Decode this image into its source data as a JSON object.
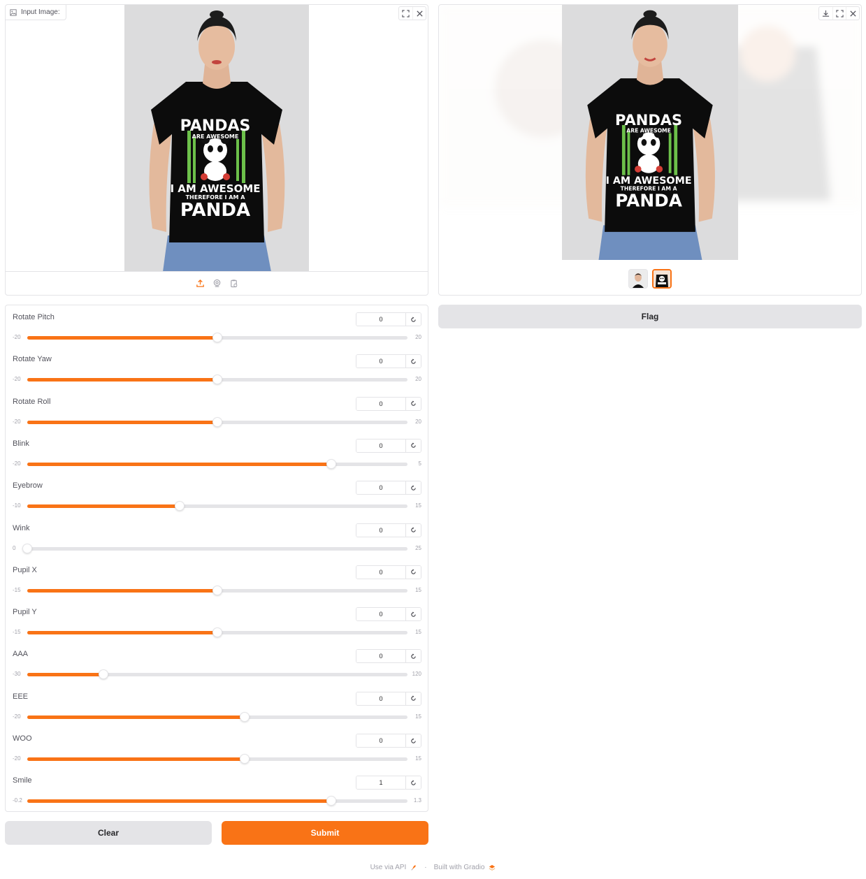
{
  "input_image": {
    "label": "Input Image:",
    "icons": [
      "image-icon",
      "fullscreen-icon",
      "close-icon"
    ],
    "sources": [
      "upload-icon",
      "webcam-icon",
      "clipboard-icon"
    ]
  },
  "output_gallery": {
    "icons": [
      "download-icon",
      "fullscreen-icon",
      "close-icon"
    ],
    "thumbnail_count": 2,
    "selected_index": 1
  },
  "shirt": {
    "line1": "PANDAS",
    "line2": "ARE AWESOME",
    "line3": "I AM AWESOME",
    "line4": "THEREFORE I AM A",
    "line5": "PANDA"
  },
  "sliders": [
    {
      "label": "Rotate Pitch",
      "value": "0",
      "min": "-20",
      "max": "20",
      "fraction": 0.5
    },
    {
      "label": "Rotate Yaw",
      "value": "0",
      "min": "-20",
      "max": "20",
      "fraction": 0.5
    },
    {
      "label": "Rotate Roll",
      "value": "0",
      "min": "-20",
      "max": "20",
      "fraction": 0.5
    },
    {
      "label": "Blink",
      "value": "0",
      "min": "-20",
      "max": "5",
      "fraction": 0.8
    },
    {
      "label": "Eyebrow",
      "value": "0",
      "min": "-10",
      "max": "15",
      "fraction": 0.4
    },
    {
      "label": "Wink",
      "value": "0",
      "min": "0",
      "max": "25",
      "fraction": 0.0
    },
    {
      "label": "Pupil X",
      "value": "0",
      "min": "-15",
      "max": "15",
      "fraction": 0.5
    },
    {
      "label": "Pupil Y",
      "value": "0",
      "min": "-15",
      "max": "15",
      "fraction": 0.5
    },
    {
      "label": "AAA",
      "value": "0",
      "min": "-30",
      "max": "120",
      "fraction": 0.2
    },
    {
      "label": "EEE",
      "value": "0",
      "min": "-20",
      "max": "15",
      "fraction": 0.571
    },
    {
      "label": "WOO",
      "value": "0",
      "min": "-20",
      "max": "15",
      "fraction": 0.571
    },
    {
      "label": "Smile",
      "value": "1",
      "min": "-0.2",
      "max": "1.3",
      "fraction": 0.8
    }
  ],
  "buttons": {
    "clear": "Clear",
    "submit": "Submit",
    "flag": "Flag"
  },
  "footer": {
    "api": "Use via API",
    "separator": "·",
    "built": "Built with Gradio"
  },
  "colors": {
    "accent": "#f97316",
    "secondary_button": "#e4e4e7"
  }
}
